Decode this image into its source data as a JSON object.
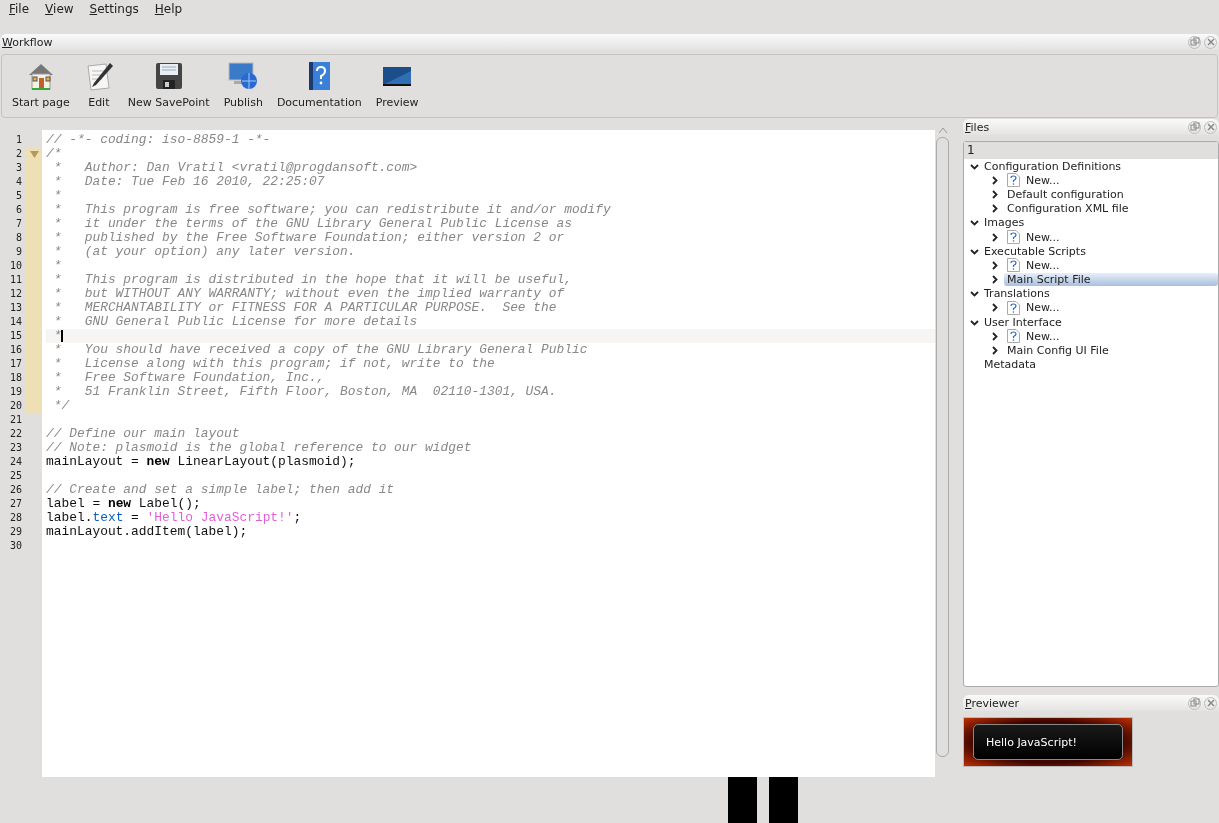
{
  "menu": [
    {
      "label": "File"
    },
    {
      "label": "View"
    },
    {
      "label": "Settings"
    },
    {
      "label": "Help"
    }
  ],
  "workflow": {
    "title": "Workflow",
    "buttons": [
      {
        "kind": "home",
        "label": "Start page"
      },
      {
        "kind": "edit",
        "label": "Edit"
      },
      {
        "kind": "save",
        "label": "New SavePoint"
      },
      {
        "kind": "publish",
        "label": "Publish"
      },
      {
        "kind": "docs",
        "label": "Documentation"
      },
      {
        "kind": "preview",
        "label": "Preview"
      }
    ]
  },
  "editor": {
    "lines": [
      {
        "number": "1",
        "segments": [
          {
            "kind": "comment",
            "text": "// -*- coding: iso-8859-1 -*-"
          }
        ]
      },
      {
        "number": "2",
        "in_fold": true,
        "fold_marker": true,
        "segments": [
          {
            "kind": "comment",
            "text": "/*"
          }
        ]
      },
      {
        "number": "3",
        "in_fold": true,
        "segments": [
          {
            "kind": "comment",
            "text": " *   Author: Dan Vratil <vratil@progdansoft.com>"
          }
        ]
      },
      {
        "number": "4",
        "in_fold": true,
        "segments": [
          {
            "kind": "comment",
            "text": " *   Date: Tue Feb 16 2010, 22:25:07"
          }
        ]
      },
      {
        "number": "5",
        "in_fold": true,
        "segments": [
          {
            "kind": "comment",
            "text": " *"
          }
        ]
      },
      {
        "number": "6",
        "in_fold": true,
        "segments": [
          {
            "kind": "comment",
            "text": " *   This program is free software; you can redistribute it and/or modify"
          }
        ]
      },
      {
        "number": "7",
        "in_fold": true,
        "segments": [
          {
            "kind": "comment",
            "text": " *   it under the terms of the GNU Library General Public License as"
          }
        ]
      },
      {
        "number": "8",
        "in_fold": true,
        "segments": [
          {
            "kind": "comment",
            "text": " *   published by the Free Software Foundation; either version 2 or"
          }
        ]
      },
      {
        "number": "9",
        "in_fold": true,
        "segments": [
          {
            "kind": "comment",
            "text": " *   (at your option) any later version."
          }
        ]
      },
      {
        "number": "10",
        "in_fold": true,
        "segments": [
          {
            "kind": "comment",
            "text": " *"
          }
        ]
      },
      {
        "number": "11",
        "in_fold": true,
        "segments": [
          {
            "kind": "comment",
            "text": " *   This program is distributed in the hope that it will be useful,"
          }
        ]
      },
      {
        "number": "12",
        "in_fold": true,
        "segments": [
          {
            "kind": "comment",
            "text": " *   but WITHOUT ANY WARRANTY; without even the implied warranty of"
          }
        ]
      },
      {
        "number": "13",
        "in_fold": true,
        "segments": [
          {
            "kind": "comment",
            "text": " *   MERCHANTABILITY or FITNESS FOR A PARTICULAR PURPOSE.  See the"
          }
        ]
      },
      {
        "number": "14",
        "in_fold": true,
        "segments": [
          {
            "kind": "comment",
            "text": " *   GNU General Public License for more details"
          }
        ]
      },
      {
        "number": "15",
        "in_fold": true,
        "current": true,
        "segments": [
          {
            "kind": "comment",
            "text": " *"
          }
        ]
      },
      {
        "number": "16",
        "in_fold": true,
        "segments": [
          {
            "kind": "comment",
            "text": " *   You should have received a copy of the GNU Library General Public"
          }
        ]
      },
      {
        "number": "17",
        "in_fold": true,
        "segments": [
          {
            "kind": "comment",
            "text": " *   License along with this program; if not, write to the"
          }
        ]
      },
      {
        "number": "18",
        "in_fold": true,
        "segments": [
          {
            "kind": "comment",
            "text": " *   Free Software Foundation, Inc.,"
          }
        ]
      },
      {
        "number": "19",
        "in_fold": true,
        "segments": [
          {
            "kind": "comment",
            "text": " *   51 Franklin Street, Fifth Floor, Boston, MA  02110-1301, USA."
          }
        ]
      },
      {
        "number": "20",
        "in_fold": true,
        "segments": [
          {
            "kind": "comment",
            "text": " */"
          }
        ]
      },
      {
        "number": "21"
      },
      {
        "number": "22",
        "segments": [
          {
            "kind": "comment",
            "text": "// Define our main layout"
          }
        ]
      },
      {
        "number": "23",
        "segments": [
          {
            "kind": "comment",
            "text": "// Note: plasmoid is the global reference to our widget"
          }
        ]
      },
      {
        "number": "24",
        "segments": [
          {
            "kind": "plain",
            "text": "mainLayout = "
          },
          {
            "kind": "keyword",
            "text": "new"
          },
          {
            "kind": "plain",
            "text": " LinearLayout(plasmoid);"
          }
        ]
      },
      {
        "number": "25"
      },
      {
        "number": "26",
        "segments": [
          {
            "kind": "comment",
            "text": "// Create and set a simple label; then add it"
          }
        ]
      },
      {
        "number": "27",
        "segments": [
          {
            "kind": "plain",
            "text": "label = "
          },
          {
            "kind": "keyword",
            "text": "new"
          },
          {
            "kind": "plain",
            "text": " Label();"
          }
        ]
      },
      {
        "number": "28",
        "segments": [
          {
            "kind": "plain",
            "text": "label."
          },
          {
            "kind": "property",
            "text": "text"
          },
          {
            "kind": "plain",
            "text": " = "
          },
          {
            "kind": "string",
            "text": "'Hello JavaScript!'"
          },
          {
            "kind": "plain",
            "text": ";"
          }
        ]
      },
      {
        "number": "29",
        "segments": [
          {
            "kind": "plain",
            "text": "mainLayout.addItem(label);"
          }
        ]
      },
      {
        "number": "30"
      }
    ]
  },
  "files": {
    "title": "Files",
    "column_header": "1",
    "tree": [
      {
        "label": "Configuration Definitions",
        "expanded": true,
        "children": [
          {
            "label": "New...",
            "kind": "new",
            "expanded": false,
            "selected": false
          },
          {
            "label": "Default configuration",
            "kind": "file",
            "expanded": false,
            "selected": false
          },
          {
            "label": "Configuration XML file",
            "kind": "file",
            "expanded": false,
            "selected": false
          }
        ]
      },
      {
        "label": "Images",
        "expanded": true,
        "children": [
          {
            "label": "New...",
            "kind": "new",
            "expanded": false,
            "selected": false
          }
        ]
      },
      {
        "label": "Executable Scripts",
        "expanded": true,
        "children": [
          {
            "label": "New...",
            "kind": "new",
            "expanded": false,
            "selected": false
          },
          {
            "label": "Main Script File",
            "kind": "file",
            "expanded": false,
            "selected": true
          }
        ]
      },
      {
        "label": "Translations",
        "expanded": true,
        "children": [
          {
            "label": "New...",
            "kind": "new",
            "expanded": false,
            "selected": false
          }
        ]
      },
      {
        "label": "User Interface",
        "expanded": true,
        "children": [
          {
            "label": "New...",
            "kind": "new",
            "expanded": false,
            "selected": false
          },
          {
            "label": "Main Config UI File",
            "kind": "file",
            "expanded": false,
            "selected": false
          }
        ]
      },
      {
        "label": "Metadata"
      }
    ]
  },
  "previewer": {
    "title": "Previewer",
    "label": "Hello JavaScript!"
  }
}
